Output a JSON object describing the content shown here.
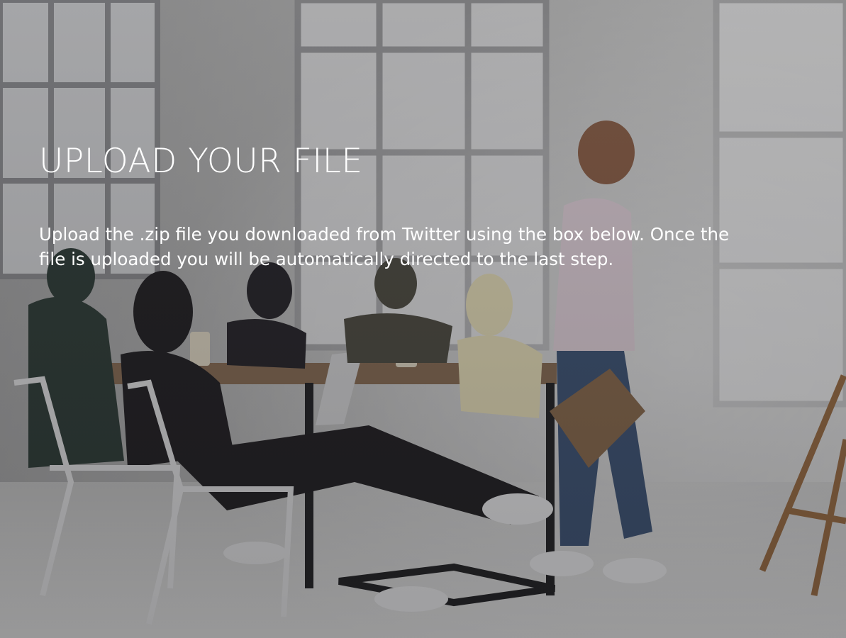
{
  "page": {
    "title": "UPLOAD YOUR FILE",
    "description": "Upload the .zip file you downloaded from Twitter using the box below. Once the file is uploaded you will be automatically directed to the last step."
  },
  "background": {
    "image_name": "office-meeting-photo",
    "overlay_color": "#2d2d32"
  },
  "colors": {
    "text": "#ffffff"
  }
}
